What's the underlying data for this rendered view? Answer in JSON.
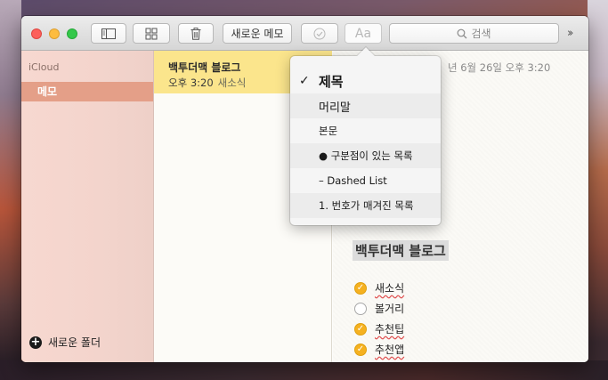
{
  "toolbar": {
    "new_note_label": "새로운 메모",
    "format_label": "Aa",
    "search_placeholder": "검색",
    "sidebar_toggle_icon": "sidebar-icon",
    "attachments_icon": "grid-icon",
    "delete_icon": "trash-icon",
    "checklist_icon": "checkmark-circle-icon",
    "more_icon": "chevrons-right-icon"
  },
  "sidebar": {
    "account": "iCloud",
    "folders": [
      {
        "label": "메모",
        "selected": true
      }
    ],
    "new_folder_label": "새로운 폴더"
  },
  "note_list": {
    "notes": [
      {
        "title": "백투더맥 블로그",
        "time": "오후 3:20",
        "preview": "새소식",
        "selected": true
      }
    ]
  },
  "editor": {
    "date_text": "년 6월 26일 오후 3:20",
    "title": "백투더맥 블로그",
    "checklist": [
      {
        "text": "새소식",
        "checked": true,
        "spell_error": true
      },
      {
        "text": "볼거리",
        "checked": false,
        "spell_error": false
      },
      {
        "text": "추천팁",
        "checked": true,
        "spell_error": true
      },
      {
        "text": "추천앱",
        "checked": true,
        "spell_error": true
      }
    ]
  },
  "format_menu": {
    "selected_index": 0,
    "items": [
      {
        "label": "제목",
        "style": "title"
      },
      {
        "label": "머리말",
        "style": "heading"
      },
      {
        "label": "본문",
        "style": "body"
      },
      {
        "label": "● 구분점이 있는 목록",
        "style": "bullet"
      },
      {
        "label": "– Dashed List",
        "style": "dashed"
      },
      {
        "label": "1. 번호가 매겨진 목록",
        "style": "numbered"
      }
    ]
  },
  "colors": {
    "accent_yellow": "#fbe58c",
    "sidebar_selected": "#e49f88",
    "checkbox_checked": "#f5b120",
    "sidebar_bg": "#f3d4cc"
  }
}
